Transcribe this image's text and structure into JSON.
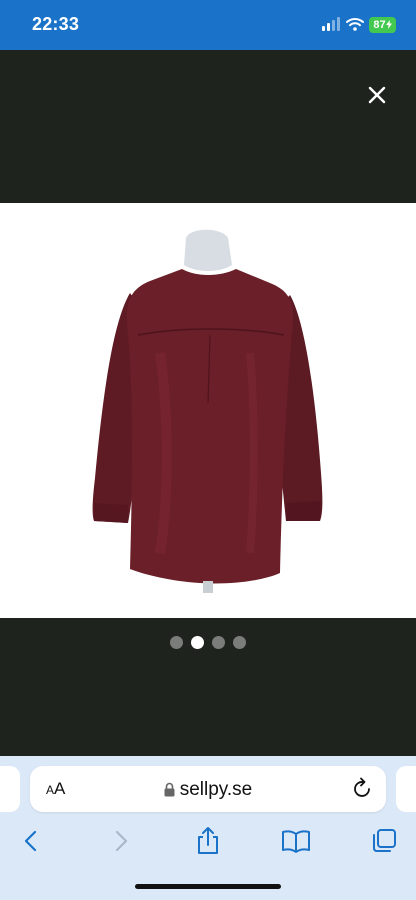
{
  "status_bar": {
    "time": "22:33",
    "battery": "87",
    "signal_icon": "cellular-signal-icon",
    "wifi_icon": "wifi-icon",
    "background_color": "#1a73c9"
  },
  "gallery": {
    "close_icon": "close-icon",
    "image_subject": "burgundy long-sleeve blouse on mannequin, back view",
    "garment_color": "#6b1f28",
    "page_count": 4,
    "active_page": 2,
    "background_color": "#1f231e"
  },
  "browser": {
    "text_size_label_small": "A",
    "text_size_label_large": "A",
    "url": "sellpy.se",
    "lock_icon": "lock-icon",
    "reload_icon": "reload-icon",
    "toolbar_icons": [
      "back-icon",
      "forward-icon",
      "share-icon",
      "bookmarks-icon",
      "tabs-icon"
    ],
    "accent_color": "#1a73c9"
  }
}
